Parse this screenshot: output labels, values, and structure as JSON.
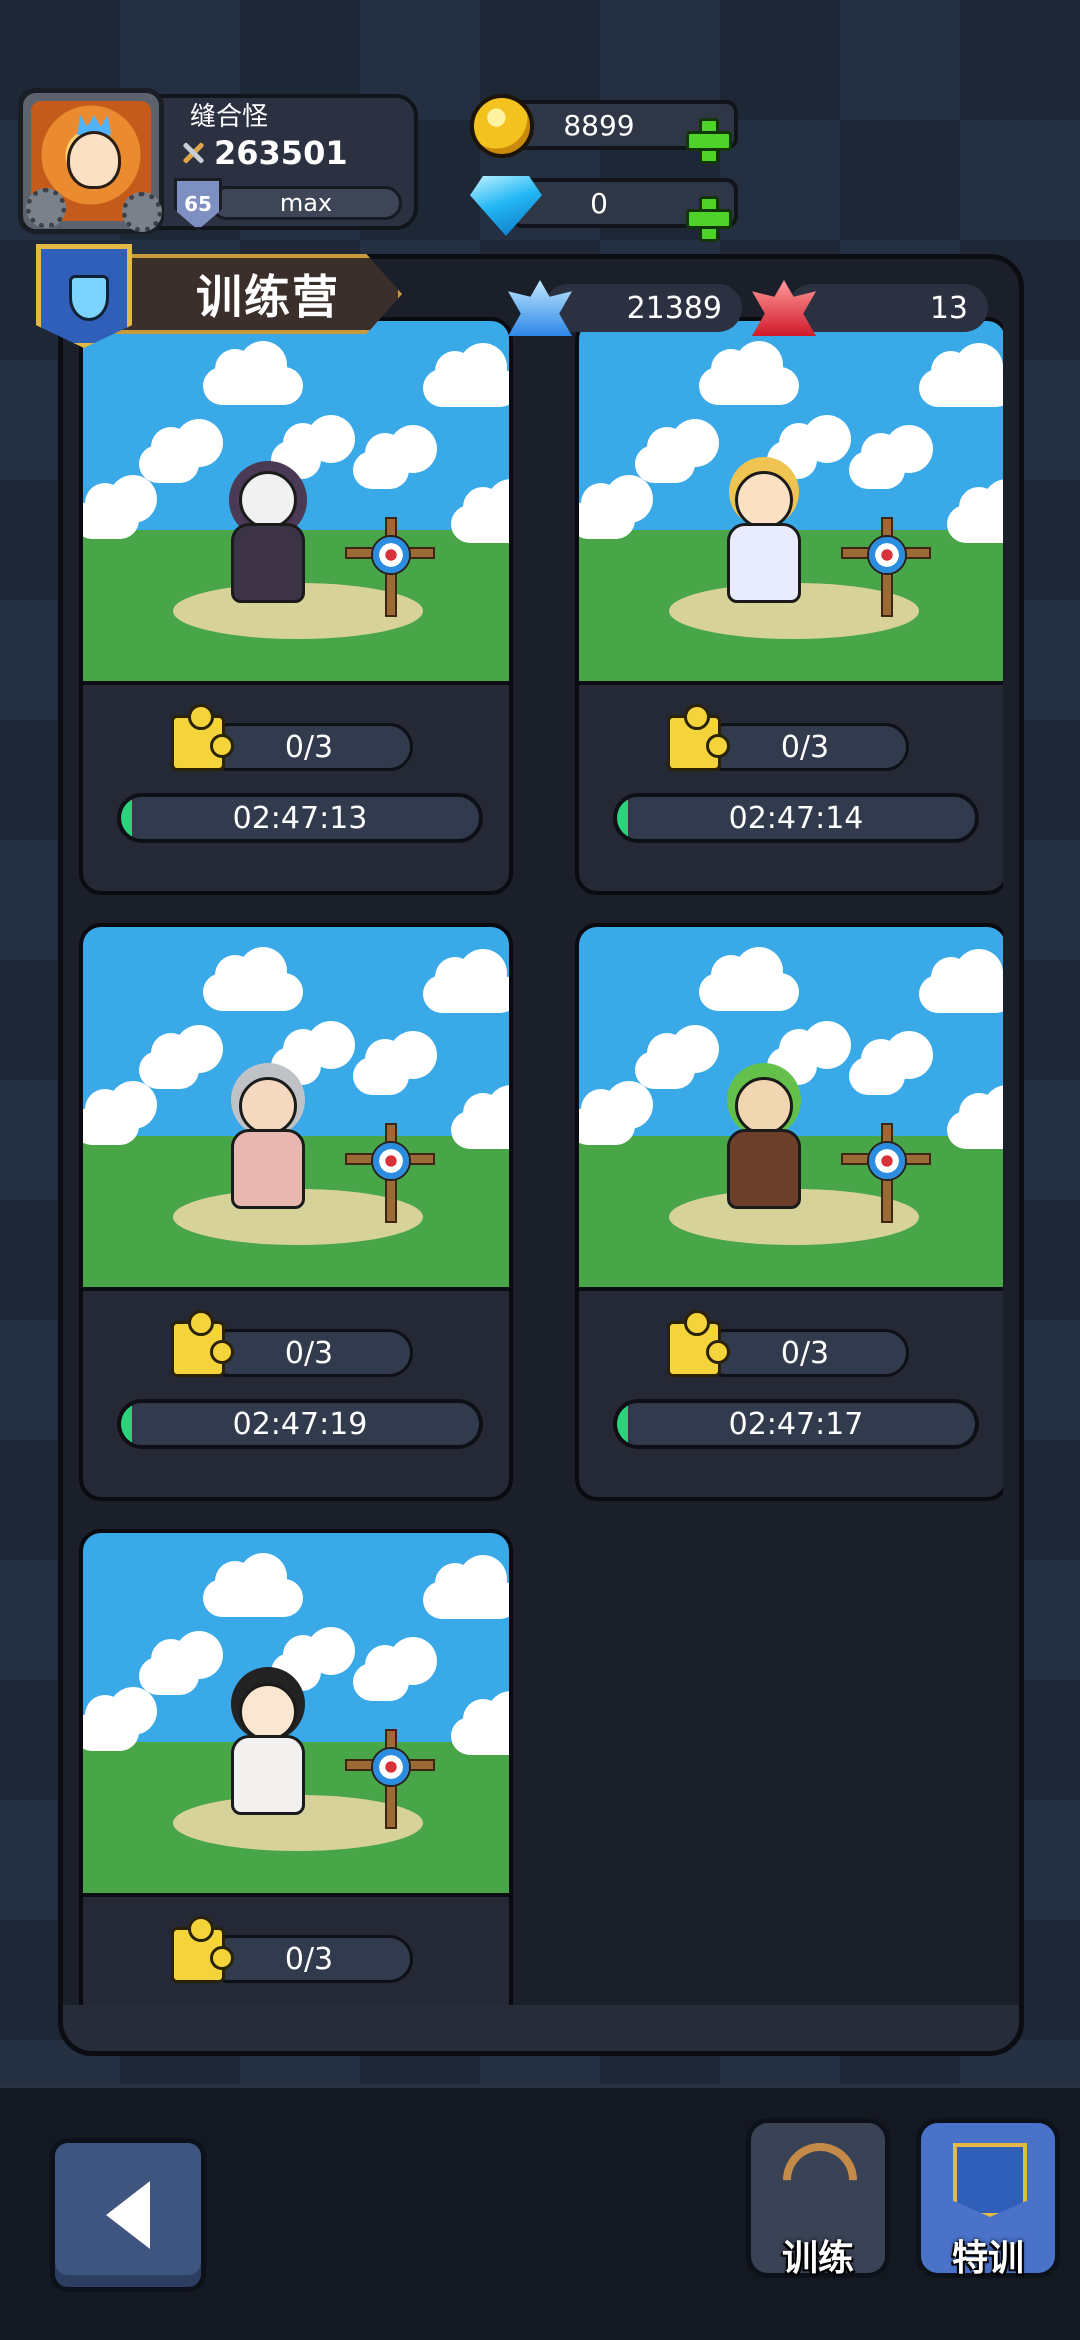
{
  "profile": {
    "name": "缝合怪",
    "power": "263501",
    "level": "65",
    "level_status": "max"
  },
  "currency": {
    "gold": "8899",
    "diamond": "0"
  },
  "panel": {
    "title": "训练营",
    "blue_crystal": "21389",
    "red_crystal": "13"
  },
  "cards": [
    {
      "hero": "reaper",
      "shards": "0/3",
      "timer": "02:47:13",
      "progress": 0.03
    },
    {
      "hero": "mage",
      "shards": "0/3",
      "timer": "02:47:14",
      "progress": 0.03
    },
    {
      "hero": "elder",
      "shards": "0/3",
      "timer": "02:47:19",
      "progress": 0.03
    },
    {
      "hero": "druid",
      "shards": "0/3",
      "timer": "02:47:17",
      "progress": 0.03
    },
    {
      "hero": "swordswoman",
      "shards": "0/3",
      "timer": "",
      "progress": 0
    }
  ],
  "bottom_nav": {
    "train_label": "训练",
    "special_label": "特训"
  },
  "colors": {
    "timer_fill": "#2bd37a",
    "special_tab_active": "#4a72c8"
  }
}
